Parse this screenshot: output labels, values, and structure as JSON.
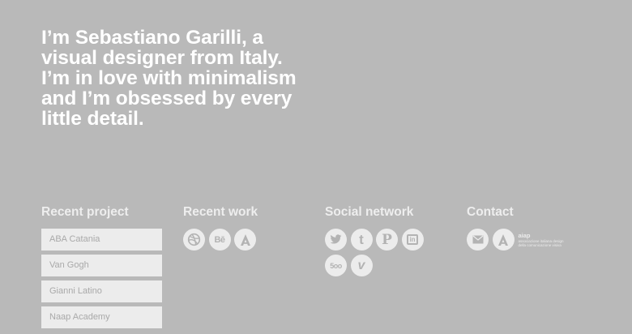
{
  "intro": {
    "lines": [
      "I’m Sebastiano Garilli, a visual designer from Italy.",
      "I’m in love with minimalism and I’m obsessed by every little detail."
    ]
  },
  "sections": {
    "recent_project": {
      "title": "Recent project",
      "items": [
        "ABA Catania",
        "Van Gogh",
        "Gianni Latino",
        "Naap Academy"
      ]
    },
    "recent_work": {
      "title": "Recent work",
      "icons": [
        "dribbble-icon",
        "behance-icon",
        "aiap-icon"
      ],
      "behance_text": "Bē"
    },
    "social_network": {
      "title": "Social network",
      "icons": [
        "twitter-icon",
        "tumblr-icon",
        "pinterest-icon",
        "linkedin-icon",
        "500px-icon",
        "vimeo-icon"
      ],
      "tumblr_text": "t",
      "pinterest_text": "P",
      "linkedin_text": "in",
      "fivehundred_text": "5oo",
      "vimeo_text": "v"
    },
    "contact": {
      "title": "Contact",
      "icons": [
        "mail-icon",
        "aiap-logo-icon"
      ],
      "aiap_name": "aiap",
      "aiap_sub_1": "associazione italiana design",
      "aiap_sub_2": "della comunicazione visiva"
    }
  },
  "colors": {
    "background": "#b9b9b9",
    "text": "#ffffff",
    "tile": "#ececec",
    "tile_text": "#a9a9a9"
  }
}
